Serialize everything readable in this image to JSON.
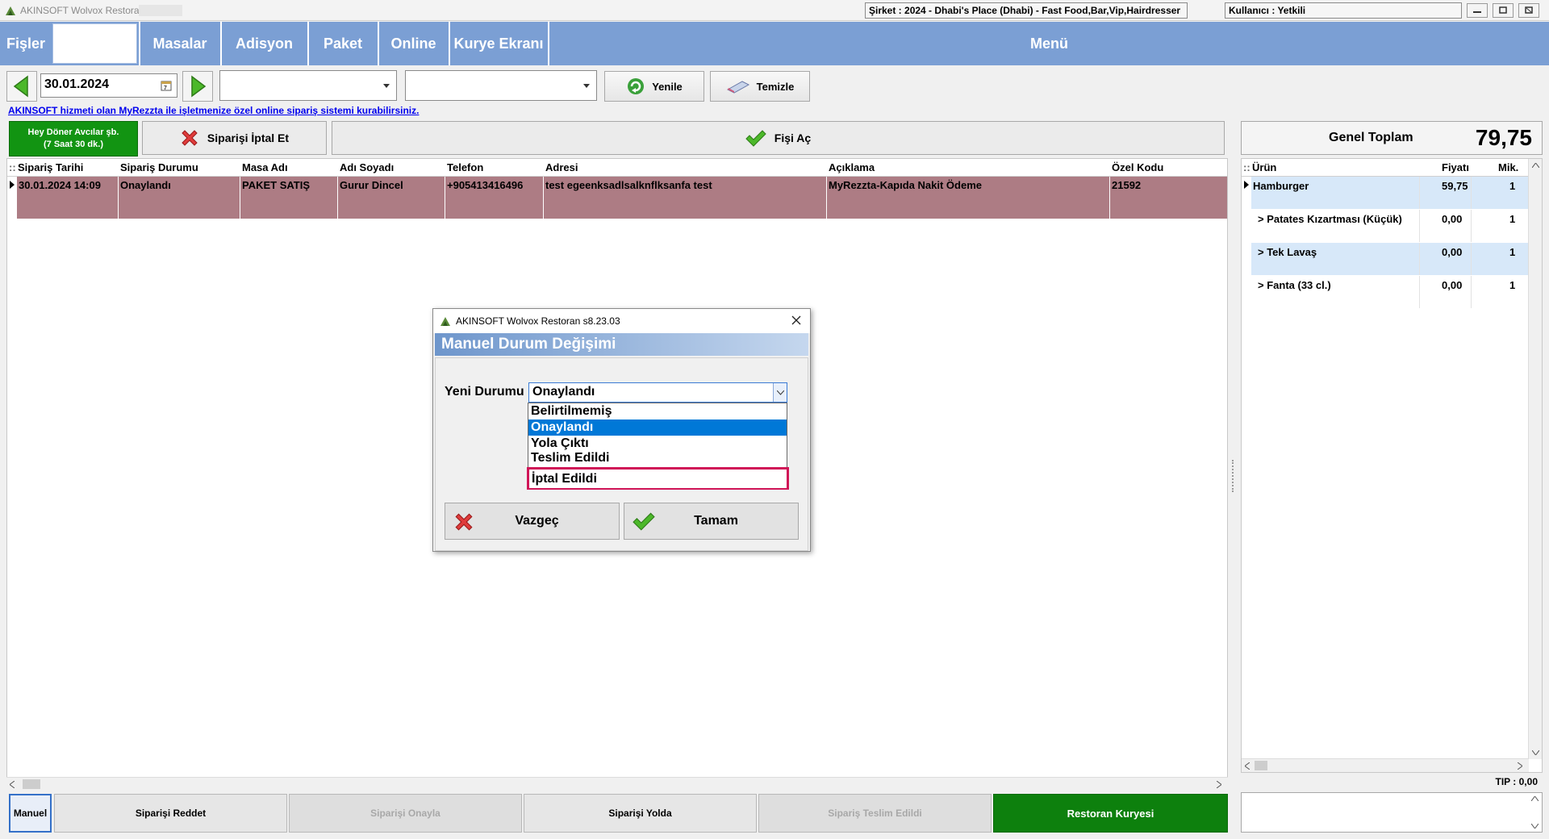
{
  "window": {
    "app_title": "AKINSOFT Wolvox Restoran",
    "company": "Şirket : 2024 - Dhabi's Place (Dhabi) - Fast Food,Bar,Vip,Hairdresser",
    "user": "Kullanıcı : Yetkili"
  },
  "nav": {
    "fisler": "Fişler",
    "masalar": "Masalar",
    "adisyon": "Adisyon",
    "paket": "Paket",
    "online": "Online",
    "kurye": "Kurye Ekranı",
    "menu": "Menü"
  },
  "toolbar": {
    "date": "30.01.2024",
    "combo1": "",
    "combo2": "",
    "refresh": "Yenile",
    "clear": "Temizle"
  },
  "info_link": "AKINSOFT hizmeti olan MyRezzta ile işletmenize özel online sipariş sistemi kurabilirsiniz.",
  "actions": {
    "restaurant_line1": "Hey Döner Avcılar şb.",
    "restaurant_line2": "(7 Saat 30 dk.)",
    "cancel_order": "Siparişi İptal Et",
    "open_receipt": "Fişi Aç"
  },
  "total": {
    "label": "Genel Toplam",
    "value": "79,75"
  },
  "orders": {
    "headers": [
      "Sipariş Tarihi",
      "Sipariş Durumu",
      "Masa Adı",
      "Adı Soyadı",
      "Telefon",
      "Adresi",
      "Açıklama",
      "Özel Kodu"
    ],
    "rows": [
      [
        "30.01.2024 14:09",
        "Onaylandı",
        "PAKET SATIŞ",
        "Gurur Dincel",
        "+905413416496",
        "test egeenksadlsalknflksanfa test",
        "MyRezzta-Kapıda Nakit Ödeme",
        "21592"
      ]
    ]
  },
  "items": {
    "headers": [
      "Ürün",
      "Fiyatı",
      "Mik."
    ],
    "rows": [
      [
        "Hamburger",
        "59,75",
        "1"
      ],
      [
        "> Patates Kızartması (Küçük)",
        "0,00",
        "1"
      ],
      [
        "> Tek Lavaş",
        "0,00",
        "1"
      ],
      [
        "> Fanta (33 cl.)",
        "0,00",
        "1"
      ]
    ],
    "tip": "TIP : 0,00"
  },
  "bottom": {
    "manuel": "Manuel",
    "reject": "Siparişi Reddet",
    "approve": "Siparişi Onayla",
    "on_way": "Siparişi Yolda",
    "delivered": "Sipariş Teslim Edildi",
    "courier": "Restoran Kuryesi"
  },
  "dialog": {
    "title": "AKINSOFT Wolvox Restoran s8.23.03",
    "header": "Manuel Durum Değişimi",
    "label": "Yeni Durumu",
    "selected": "Onaylandı",
    "options": [
      "Belirtilmemiş",
      "Onaylandı",
      "Yola Çıktı",
      "Teslim Edildi",
      "İptal Edildi"
    ],
    "cancel": "Vazgeç",
    "ok": "Tamam"
  },
  "colors": {
    "nav_bg": "#7b9fd4",
    "row_selected": "#ad7c84",
    "green": "#129412",
    "highlight": "#d01557"
  }
}
